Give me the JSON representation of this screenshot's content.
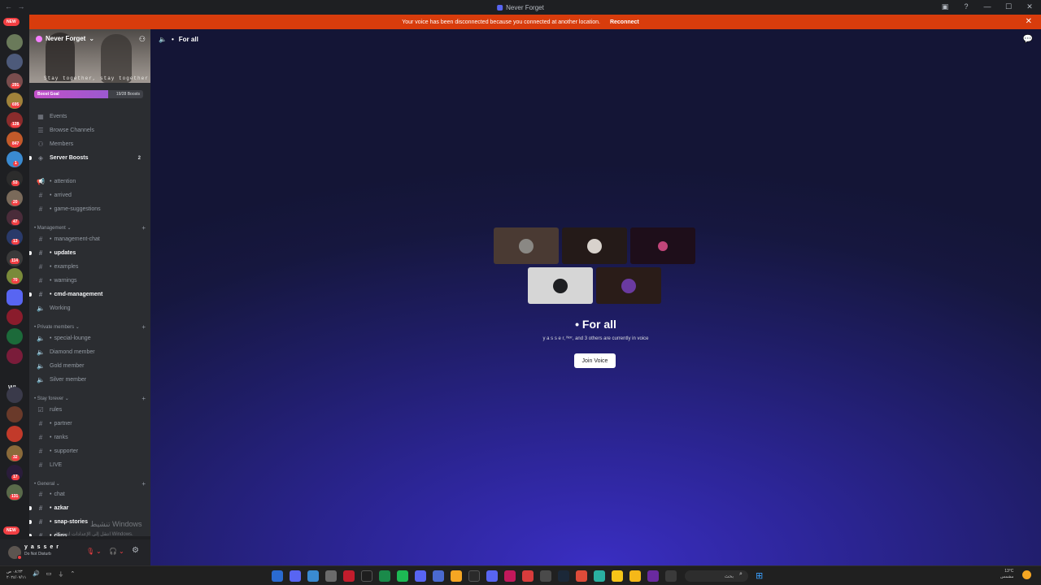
{
  "window": {
    "title": "Never Forget",
    "nav_arrows": "← →"
  },
  "notice": {
    "message": "Your voice has been disconnected because you connected at another location.",
    "action": "Reconnect"
  },
  "rail": {
    "new_label": "NEW",
    "wl_label": "WL",
    "badges": [
      "291",
      "695",
      "128",
      "847",
      "1",
      "53",
      "20",
      "47",
      "13",
      "114",
      "70",
      "32",
      "17",
      "131"
    ]
  },
  "server": {
    "name": "Never Forget",
    "banner_text": "Stay together, stay together",
    "boost_goal_label": "Boost Goal",
    "boost_count": "19/28 Boosts",
    "boost_progress": 0.68
  },
  "nav": {
    "events": "Events",
    "browse_channels": "Browse Channels",
    "members": "Members",
    "server_boosts": "Server Boosts",
    "server_boosts_count": "2"
  },
  "channels_top": [
    "attention",
    "arrived",
    "game-suggestions"
  ],
  "categories": {
    "management": "Management",
    "private_members": "Private members",
    "stay_forever": "Stay forever",
    "general": "General"
  },
  "management_channels": [
    "management-chat",
    "updates",
    "examples",
    "warnings",
    "cmd-management",
    "Working"
  ],
  "private_channels": [
    "special-lounge",
    "Diamond member",
    "Gold member",
    "Silver member"
  ],
  "stay_channels": [
    "rules",
    "partner",
    "ranks",
    "supporter",
    "LIVE"
  ],
  "general_channels": [
    "chat",
    "azkar",
    "snap-stories",
    "clips"
  ],
  "watermark": {
    "line1": "تنشيط Windows",
    "line2": "انتقل إلى الإعدادات لتنشيط Windows."
  },
  "user": {
    "name": "y a s s e r",
    "status": "Do Not Disturb"
  },
  "voice": {
    "channel_name": "For all",
    "occupants_text": "y a s s e r, ᴺᵒᶦʳ, and 3 others are currently in voice",
    "join_label": "Join Voice"
  },
  "taskbar": {
    "clock_line1": "٠٨:٢٣ ص",
    "clock_line2": "٢٠٢٤/٠٧/١١",
    "search_placeholder": "بحث",
    "weather_temp": "13°C",
    "weather_desc": "مشمس"
  },
  "colors": {
    "notice": "#d83c0c",
    "accent": "#5865f2",
    "dnd": "#f23f43"
  }
}
